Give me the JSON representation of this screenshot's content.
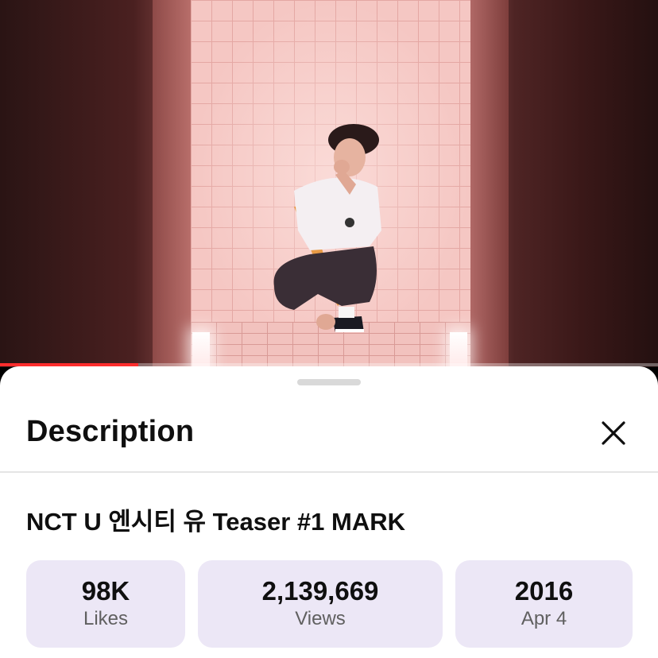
{
  "video": {
    "progress_fraction": 0.21
  },
  "sheet": {
    "title": "Description",
    "video_title": "NCT U 엔시티 유 Teaser #1 MARK",
    "stats": {
      "likes": {
        "value": "98K",
        "label": "Likes"
      },
      "views": {
        "value": "2,139,669",
        "label": "Views"
      },
      "date": {
        "value": "2016",
        "label": "Apr 4"
      }
    }
  },
  "icons": {
    "close": "close-icon"
  },
  "colors": {
    "progress": "#ff2d2d",
    "stat_background": "#ece7f6",
    "tile_pink": "#f5c7c3"
  }
}
